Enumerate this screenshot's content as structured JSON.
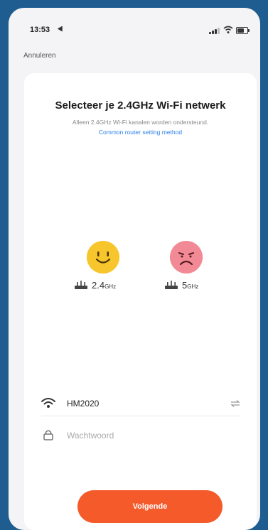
{
  "status_bar": {
    "time": "13:53"
  },
  "header": {
    "cancel_label": "Annuleren"
  },
  "main": {
    "title": "Selecteer je 2.4GHz Wi-Fi netwerk",
    "subtitle": "Alleen 2.4GHz Wi-Fi kanalen worden ondersteund.",
    "help_link": "Common router setting method",
    "bands": [
      {
        "value": "2.4",
        "unit": "GHz",
        "supported": true
      },
      {
        "value": "5",
        "unit": "GHz",
        "supported": false
      }
    ]
  },
  "form": {
    "network_name": "HM2020",
    "password_placeholder": "Wachtwoord"
  },
  "actions": {
    "next_label": "Volgende"
  },
  "colors": {
    "accent": "#f45a2a",
    "link": "#2a7fe8",
    "happy": "#f7c52c",
    "sad": "#f28a96"
  }
}
